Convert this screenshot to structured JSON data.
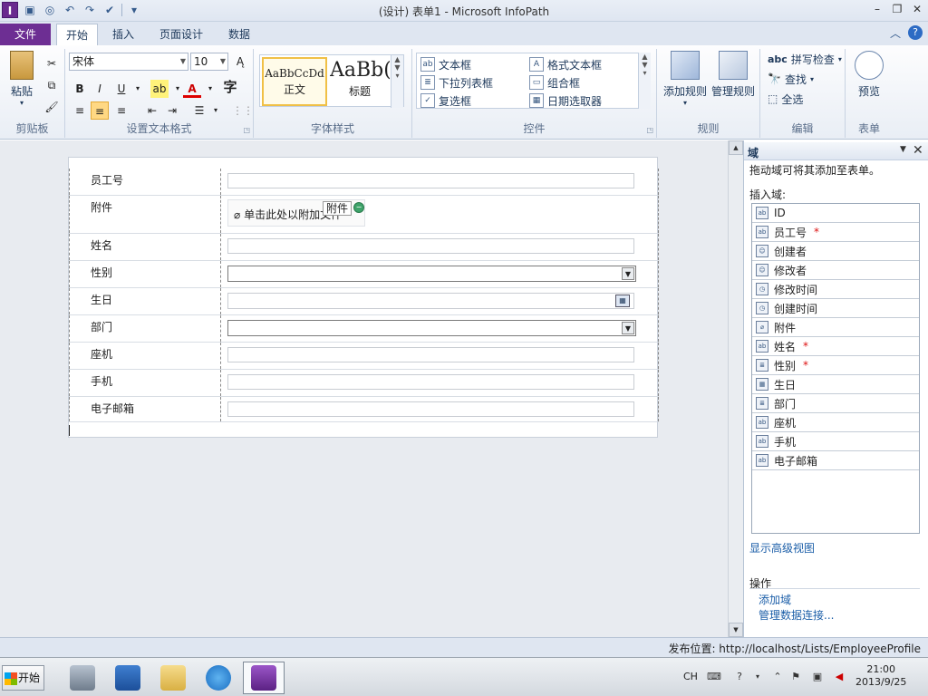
{
  "window": {
    "title": "(设计) 表单1 - Microsoft InfoPath"
  },
  "ribbon": {
    "tabs": [
      {
        "label": "文件"
      },
      {
        "label": "开始"
      },
      {
        "label": "插入"
      },
      {
        "label": "页面设计"
      },
      {
        "label": "数据"
      }
    ],
    "clipboard": {
      "paste": "粘贴",
      "group": "剪贴板"
    },
    "font": {
      "name": "宋体",
      "size": "10",
      "group": "设置文本格式",
      "bold": "B",
      "italic": "I",
      "underline": "U",
      "char_btn": "字"
    },
    "styles": {
      "normal_sample": "AaBbCcDd",
      "normal_label": "正文",
      "heading_sample": "AaBb(",
      "heading_label": "标题",
      "group": "字体样式"
    },
    "controls": {
      "items": [
        "文本框",
        "格式文本框",
        "下拉列表框",
        "组合框",
        "复选框",
        "日期选取器"
      ],
      "group": "控件"
    },
    "rules": {
      "add": "添加规则",
      "manage": "管理规则",
      "group": "规则"
    },
    "editing": {
      "spell": "拼写检查",
      "find": "查找",
      "select_all": "全选",
      "group": "编辑"
    },
    "form": {
      "preview": "预览",
      "group": "表单"
    }
  },
  "form": {
    "rows": [
      {
        "label": "员工号"
      },
      {
        "label": "附件"
      },
      {
        "label": "姓名"
      },
      {
        "label": "性别"
      },
      {
        "label": "生日"
      },
      {
        "label": "部门"
      },
      {
        "label": "座机"
      },
      {
        "label": "手机"
      },
      {
        "label": "电子邮箱"
      }
    ],
    "attach_text": "单击此处以附加文件",
    "attach_tip": "附件"
  },
  "pane": {
    "title": "域",
    "hint": "拖动域可将其添加至表单。",
    "insert_label": "插入域:",
    "fields": [
      {
        "name": "ID",
        "icon": "text-field-icon",
        "required": ""
      },
      {
        "name": "员工号",
        "icon": "text-field-icon",
        "required": "*"
      },
      {
        "name": "创建者",
        "icon": "person-field-icon",
        "required": ""
      },
      {
        "name": "修改者",
        "icon": "person-field-icon",
        "required": ""
      },
      {
        "name": "修改时间",
        "icon": "datetime-field-icon",
        "required": ""
      },
      {
        "name": "创建时间",
        "icon": "datetime-field-icon",
        "required": ""
      },
      {
        "name": "附件",
        "icon": "attachment-field-icon",
        "required": ""
      },
      {
        "name": "姓名",
        "icon": "text-field-icon",
        "required": "*"
      },
      {
        "name": "性别",
        "icon": "choice-field-icon",
        "required": "*"
      },
      {
        "name": "生日",
        "icon": "date-field-icon",
        "required": ""
      },
      {
        "name": "部门",
        "icon": "choice-field-icon",
        "required": ""
      },
      {
        "name": "座机",
        "icon": "text-field-icon",
        "required": ""
      },
      {
        "name": "手机",
        "icon": "text-field-icon",
        "required": ""
      },
      {
        "name": "电子邮箱",
        "icon": "text-field-icon",
        "required": ""
      }
    ],
    "advanced_link": "显示高级视图",
    "ops_label": "操作",
    "op_add": "添加域",
    "op_manage": "管理数据连接..."
  },
  "status": {
    "publish": "发布位置: http://localhost/Lists/EmployeeProfile"
  },
  "taskbar": {
    "start": "开始",
    "lang": "CH",
    "time": "21:00",
    "date": "2013/9/25"
  },
  "colors": {
    "file_tab": "#6d2e93",
    "link": "#1b5ea8",
    "required": "#dd1111"
  }
}
